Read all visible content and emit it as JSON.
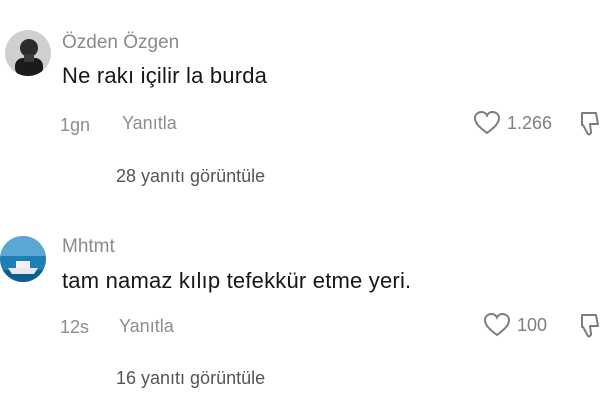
{
  "comments": [
    {
      "username": "Özden Özgen",
      "text": "Ne rakı içilir la burda",
      "time": "1gn",
      "reply_label": "Yanıtla",
      "like_count": "1.266",
      "view_replies": "28 yanıtı görüntüle",
      "avatar_icon": "portrait-photo-icon"
    },
    {
      "username": "Mhtmt",
      "text": "tam namaz kılıp tefekkür etme yeri.",
      "time": "12s",
      "reply_label": "Yanıtla",
      "like_count": "100",
      "view_replies": "16 yanıtı görüntüle",
      "avatar_icon": "boat-photo-icon"
    }
  ],
  "colors": {
    "username": "#8a8a8a",
    "text": "#161616",
    "meta": "#8d8d8d",
    "replies": "#555555"
  }
}
